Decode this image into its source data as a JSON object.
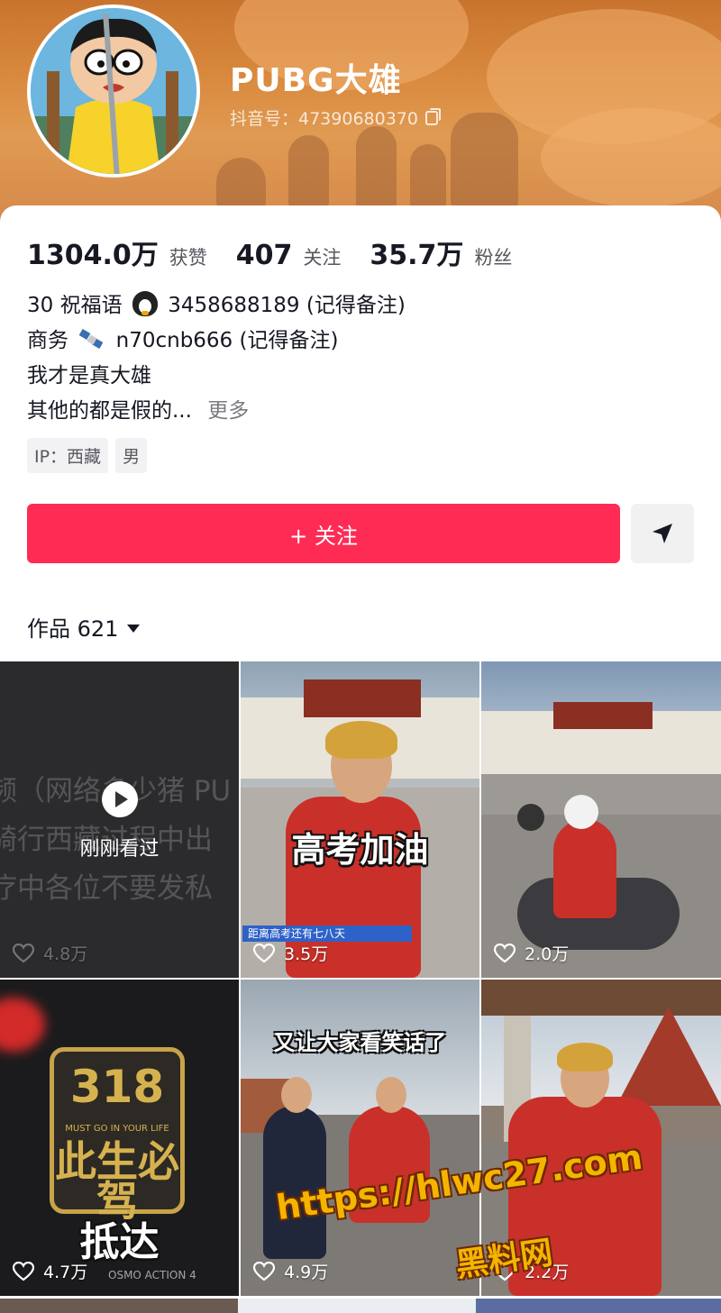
{
  "profile": {
    "name": "PUBG大雄",
    "douyin_id": "抖音号：47390680370",
    "stats": [
      {
        "value": "1304.0万",
        "label": "获赞"
      },
      {
        "value": "407",
        "label": "关注"
      },
      {
        "value": "35.7万",
        "label": "粉丝"
      }
    ],
    "bio": {
      "line1_prefix": "30 祝福语",
      "line1_suffix": "3458688189 (记得备注)",
      "line2_prefix": "商务",
      "line2_suffix": "n70cnb666 (记得备注)",
      "line3": "我才是真大雄",
      "line4": "其他的都是假的...",
      "more": "更多"
    },
    "tags": [
      "IP：西藏",
      "男"
    ]
  },
  "actions": {
    "follow_label": "+ 关注",
    "share_icon": "send-icon"
  },
  "works_tab": {
    "label": "作品 621"
  },
  "videos": [
    {
      "likes": "4.8万",
      "overlay": "",
      "status": "刚刚看过",
      "bg_text": [
        "频（网络多少猪 PU",
        "骑行西藏过程中出",
        "疗中各位不要发私"
      ]
    },
    {
      "likes": "3.5万",
      "overlay": "高考加油",
      "caption": "距离高考还有七八天"
    },
    {
      "likes": "2.0万",
      "overlay": ""
    },
    {
      "likes": "4.7万",
      "overlay": "抵达",
      "plate_number": "318",
      "plate_slogan": "MUST GO IN YOUR LIFE",
      "plate_big": "此生必驾",
      "corner_text": "OSMO ACTION 4"
    },
    {
      "likes": "4.9万",
      "overlay": "又让大家看笑话了"
    },
    {
      "likes": "2.2万",
      "overlay": ""
    }
  ],
  "watermark": {
    "url": "https://hlwc27.com",
    "name": "黑料网"
  },
  "colors": {
    "follow_red": "#fe2c55",
    "banner_orange": "#d98a3e"
  }
}
